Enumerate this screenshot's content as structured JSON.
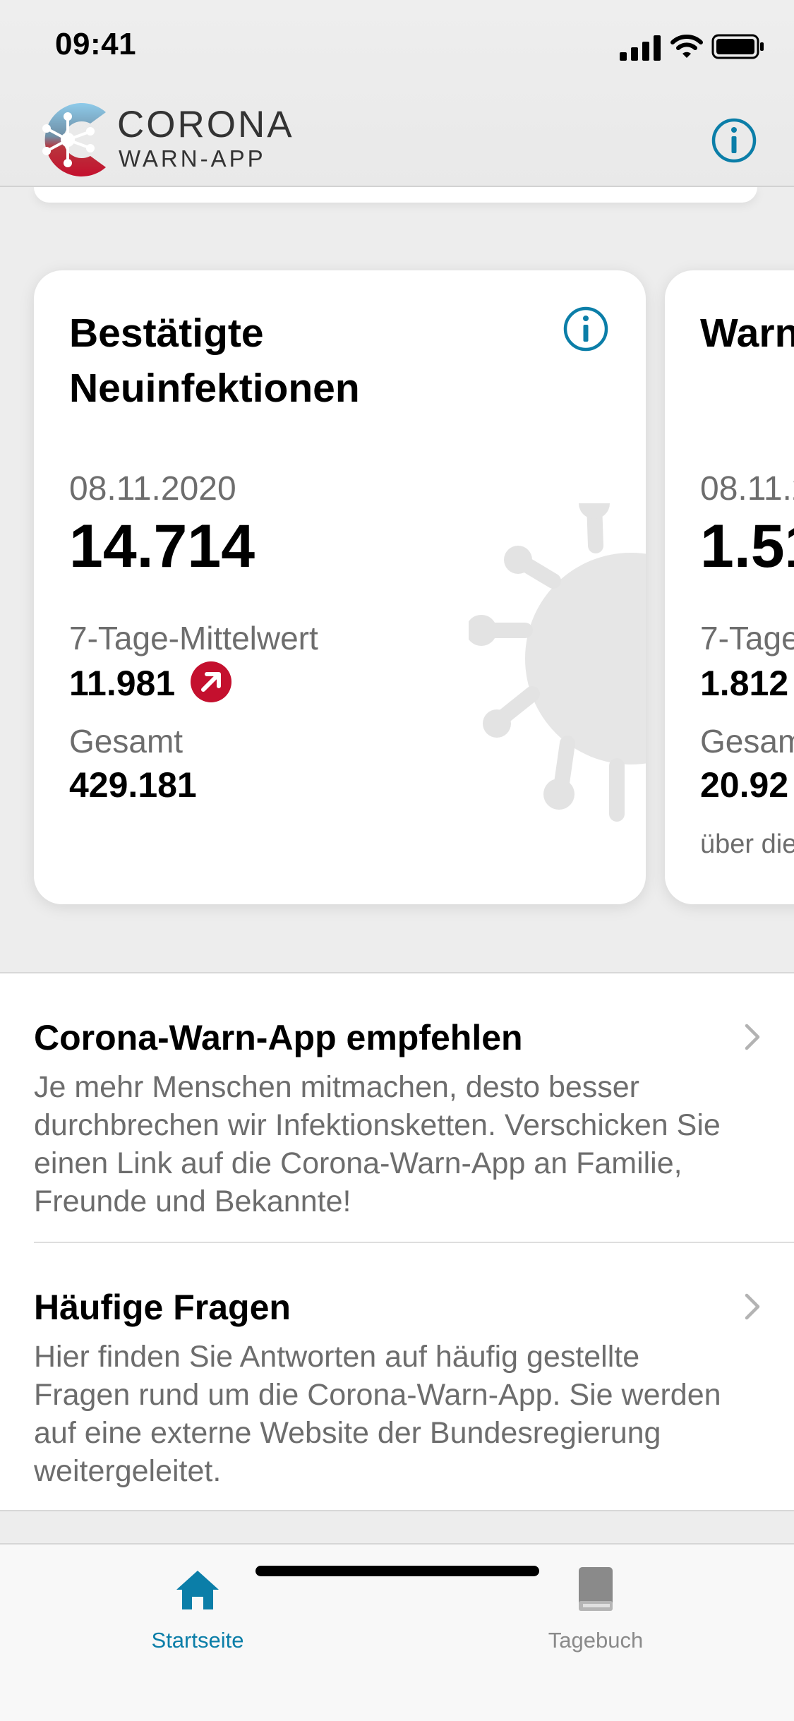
{
  "status_bar": {
    "time": "09:41"
  },
  "header": {
    "logo_line1": "CORONA",
    "logo_line2": "WARN-APP",
    "accent_color": "#0b7ea8"
  },
  "stats_cards": [
    {
      "title_line1": "Bestätigte",
      "title_line2": "Neuinfektionen",
      "date": "08.11.2020",
      "value": "14.714",
      "avg_label": "7-Tage-Mittelwert",
      "avg_value": "11.981",
      "trend": "up",
      "trend_color": "#c4102e",
      "total_label": "Gesamt",
      "total_value": "429.181"
    },
    {
      "title_partial": "Warn",
      "date_partial": "08.11.2",
      "value_partial": "1.51",
      "avg_label_partial": "7-Tage",
      "avg_value_partial": "1.812",
      "total_label_partial": "Gesam",
      "total_value_partial": "20.92",
      "note_partial": "über die"
    }
  ],
  "list": [
    {
      "title": "Corona-Warn-App empfehlen",
      "body": "Je mehr Menschen mitmachen, desto besser durchbrechen wir Infektionsketten. Verschicken Sie einen Link auf die Corona-Warn-App an Familie, Freunde und Bekannte!"
    },
    {
      "title": "Häufige Fragen",
      "body": "Hier finden Sie Antworten auf häufig gestellte Fragen rund um die Corona-Warn-App. Sie werden auf eine externe Website der Bundesregierung weitergeleitet."
    }
  ],
  "tabs": [
    {
      "label": "Startseite",
      "icon": "home-icon",
      "active": true,
      "color": "#0b7ea8"
    },
    {
      "label": "Tagebuch",
      "icon": "book-icon",
      "active": false,
      "color": "#8a8a8a"
    }
  ]
}
